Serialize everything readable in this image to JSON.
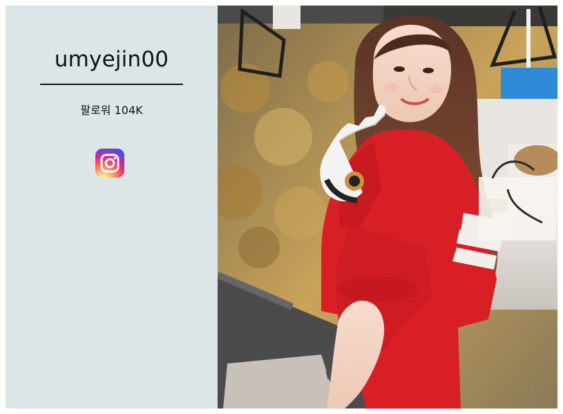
{
  "profile": {
    "username": "umyejin00",
    "followers_label": "팔로워 104K",
    "social_icon": "instagram-icon"
  },
  "photo": {
    "icon": "photo-image"
  },
  "colors": {
    "panel_background": "#dce5e7",
    "text": "#111111",
    "sweater_red": "#d81f26"
  }
}
